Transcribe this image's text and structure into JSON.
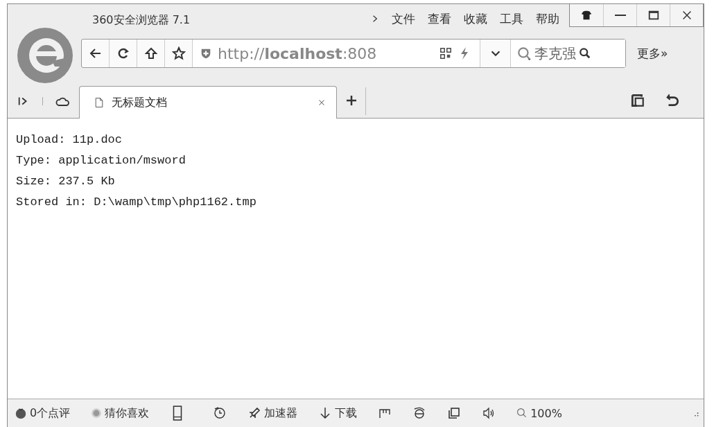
{
  "window": {
    "title": "360安全浏览器 7.1"
  },
  "menu": [
    {
      "label": "文件"
    },
    {
      "label": "查看"
    },
    {
      "label": "收藏"
    },
    {
      "label": "工具"
    },
    {
      "label": "帮助"
    }
  ],
  "address_bar": {
    "url": "http://**localhost**:808"
  },
  "search": {
    "value": "李克强"
  },
  "more": "更多»",
  "tabs": [
    {
      "label": "无标题文档",
      "selected": true
    }
  ],
  "content": [
    "Upload: 11p.doc",
    "Type: application/msword",
    "Size: 237.5 Kb",
    "Stored in: D:\\wamp\\tmp\\php1162.tmp"
  ],
  "status_bar": {
    "comments": "0个点评",
    "guess": "猜你喜欢",
    "accelerator": "加速器",
    "download": "下载",
    "zoom": "100%"
  }
}
